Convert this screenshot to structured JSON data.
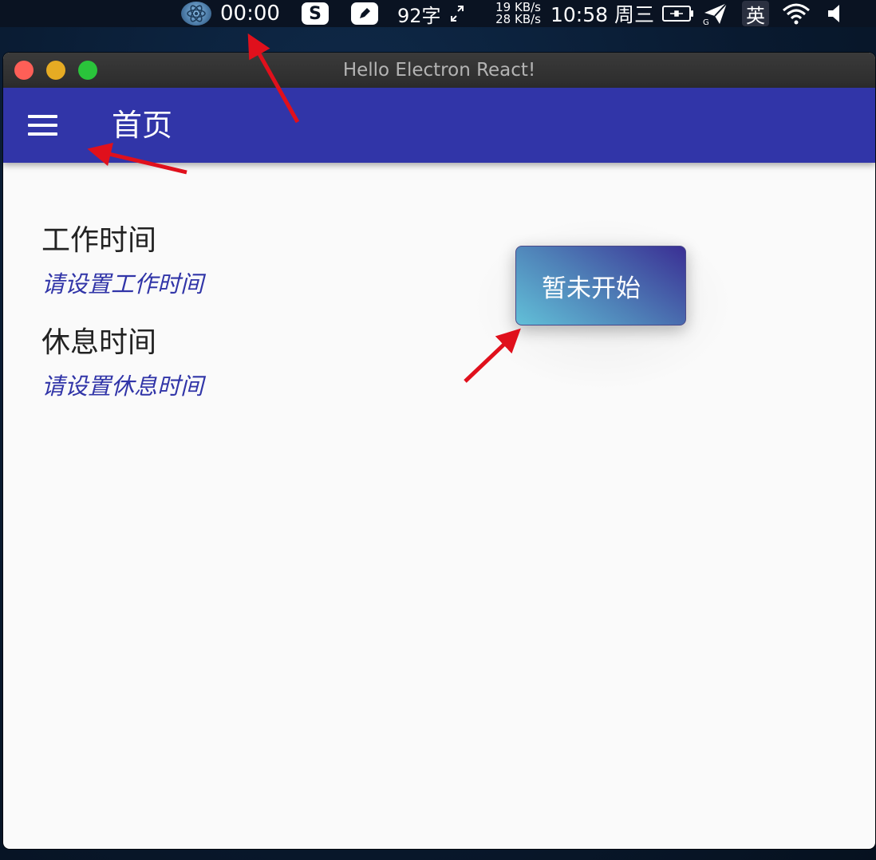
{
  "menubar": {
    "timer": "00:00",
    "sogou_glyph": "S",
    "word_count": "92字",
    "net_up": "19 KB/s",
    "net_down": "28 KB/s",
    "clock": "10:58 周三",
    "ime": "英",
    "icons": [
      "atom-icon",
      "sogou-icon",
      "pen-icon",
      "expand-icon",
      "battery-icon",
      "send-icon",
      "wifi-icon",
      "volume-icon"
    ]
  },
  "window": {
    "title": "Hello Electron React!"
  },
  "appbar": {
    "title": "首页"
  },
  "main": {
    "work_label": "工作时间",
    "work_hint": "请设置工作时间",
    "rest_label": "休息时间",
    "rest_hint": "请设置休息时间",
    "start_button": "暂未开始"
  },
  "colors": {
    "appbar": "#3135a8",
    "hint_text": "#3135a8",
    "annotation_arrow": "#e0101c",
    "traffic_close": "#fe5f57",
    "traffic_min": "#e6ab23",
    "traffic_max": "#2ac43b"
  }
}
